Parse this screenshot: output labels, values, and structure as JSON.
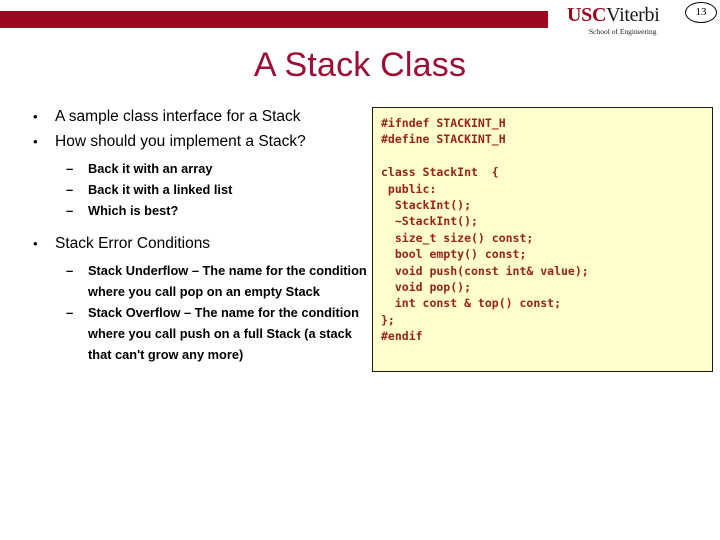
{
  "header": {
    "brand_bar_color": "#9d0821",
    "logo": {
      "usc": "USC",
      "viterbi": "Viterbi",
      "school": "School of Engineering"
    },
    "page_number": "13"
  },
  "title": "A Stack Class",
  "content": {
    "bullets": [
      {
        "level": 1,
        "marker": "•",
        "text": "A sample class interface for a Stack"
      },
      {
        "level": 1,
        "marker": "•",
        "text": "How should you implement a Stack?"
      },
      {
        "level": 2,
        "marker": "–",
        "text": "Back it with an array"
      },
      {
        "level": 2,
        "marker": "–",
        "text": "Back it with a linked list"
      },
      {
        "level": 2,
        "marker": "–",
        "text": "Which is best?"
      },
      {
        "level": 1,
        "marker": "•",
        "text": "Stack Error Conditions"
      },
      {
        "level": 2,
        "marker": "–",
        "text": "Stack Underflow – The name for the condition where you call pop on an empty Stack"
      },
      {
        "level": 2,
        "marker": "–",
        "text": "Stack Overflow – The name for the condition where you call push on a full Stack (a stack that can't grow any more)"
      }
    ]
  },
  "code_panel": {
    "background_color": "#ffffcc",
    "text_color": "#99221a",
    "code": "#ifndef STACKINT_H\n#define STACKINT_H\n\nclass StackInt  {\n public:\n  StackInt();\n  ~StackInt();\n  size_t size() const;\n  bool empty() const;\n  void push(const int& value);\n  void pop();\n  int const & top() const;\n};\n#endif"
  }
}
